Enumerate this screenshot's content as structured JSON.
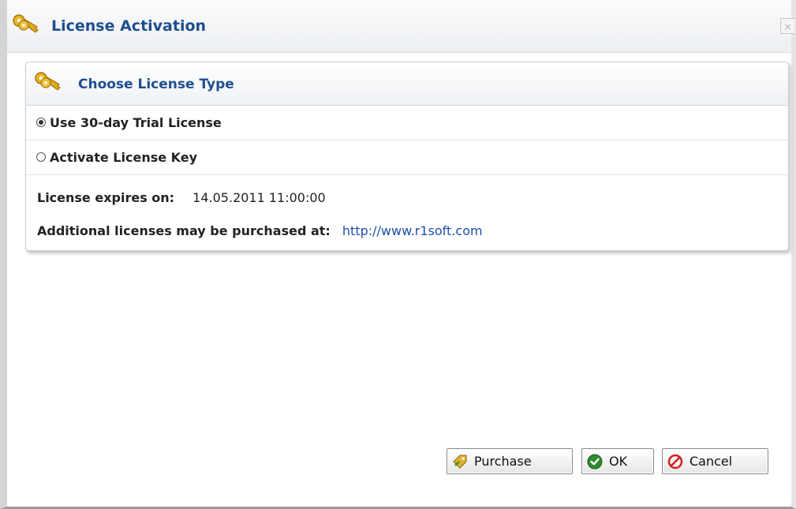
{
  "window": {
    "title": "License Activation",
    "close_label": "×"
  },
  "panel": {
    "title": "Choose License Type",
    "options": [
      {
        "label": "Use 30-day Trial License",
        "selected": true
      },
      {
        "label": "Activate License Key",
        "selected": false
      }
    ],
    "expires_label": "License expires on:",
    "expires_value": "14.05.2011 11:00:00",
    "purchase_label": "Additional licenses may be purchased at:",
    "purchase_url": "http://www.r1soft.com"
  },
  "buttons": {
    "purchase": "Purchase",
    "ok": "OK",
    "cancel": "Cancel"
  },
  "colors": {
    "title": "#1f4e8f",
    "link": "#1f4fa8",
    "key_icon": "#e0a818",
    "ok_icon": "#2e8b2e",
    "cancel_icon": "#d42020"
  },
  "icons": {
    "title": "keys-icon",
    "panel": "keys-icon",
    "purchase": "purchase-tag-icon",
    "ok": "check-circle-icon",
    "cancel": "no-entry-icon"
  }
}
